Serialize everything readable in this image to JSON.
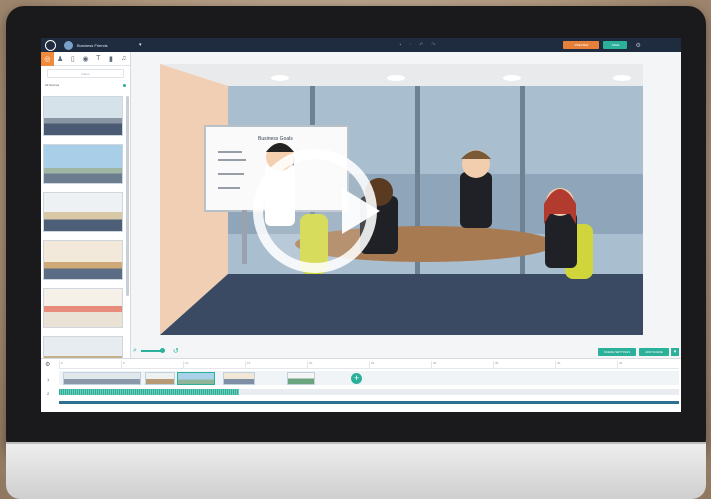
{
  "app": {
    "project_title": "Business Friends"
  },
  "topbar": {
    "preview_label": "PREVIEW",
    "save_label": "SAVE"
  },
  "left_panel": {
    "search_placeholder": "Filters",
    "category_label": "All Scenes"
  },
  "editor": {
    "scene_settings_label": "SCENE SETTINGS",
    "add_scene_label": "ADD SCENE"
  },
  "timeline": {
    "ruler_ticks": [
      "0",
      "5",
      "10",
      "15",
      "20",
      "25",
      "30",
      "35",
      "40",
      "45"
    ],
    "row_labels": [
      "1",
      "2"
    ]
  },
  "whiteboard": {
    "heading": "Business Goals"
  },
  "colors": {
    "accent_teal": "#2bb09a",
    "accent_orange": "#e5813a",
    "topbar": "#1f2b3f"
  },
  "icons": {
    "play": "play-icon",
    "zoom": "zoom-icon",
    "undo": "undo-icon",
    "add": "plus-icon",
    "gear": "gear-icon"
  }
}
